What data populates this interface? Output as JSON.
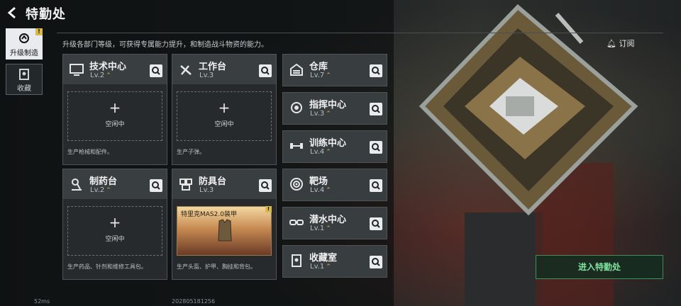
{
  "header": {
    "title": "特勤处",
    "subtitle": "升级各部门等级，可获得专属能力提升，和制造战斗物资的能力。"
  },
  "nav": [
    {
      "label": "升级制造",
      "icon": "upgrade-icon",
      "badge": "!",
      "active": true
    },
    {
      "label": "收藏",
      "icon": "collection-icon",
      "active": false
    }
  ],
  "cards": [
    {
      "name": "技术中心",
      "level": "Lv.2",
      "icon": "monitor-icon",
      "slot_label": "空闲中",
      "slot_plus": "+",
      "desc": "生产枪械和配件。"
    },
    {
      "name": "工作台",
      "level": "Lv.3",
      "icon": "hammer-icon",
      "slot_label": "空闲中",
      "slot_plus": "+",
      "desc": "生产子弹。"
    },
    {
      "name": "制药台",
      "level": "Lv.2",
      "icon": "microscope-icon",
      "slot_label": "空闲中",
      "slot_plus": "+",
      "desc": "生产药品、针剂和维修工具包。"
    },
    {
      "name": "防具台",
      "level": "Lv.3",
      "icon": "armor-icon",
      "product": "特里克MAS2.0装甲",
      "product_badge": "!",
      "desc": "生产头盔、护甲、胸挂和背包。"
    }
  ],
  "facilities": [
    {
      "name": "仓库",
      "level": "Lv.7",
      "icon": "warehouse-icon"
    },
    {
      "name": "指挥中心",
      "level": "Lv.3",
      "icon": "command-icon"
    },
    {
      "name": "训练中心",
      "level": "Lv.4",
      "icon": "dumbbell-icon"
    },
    {
      "name": "靶场",
      "level": "Lv.4",
      "icon": "target-icon"
    },
    {
      "name": "潜水中心",
      "level": "Lv.1",
      "icon": "goggles-icon"
    },
    {
      "name": "收藏室",
      "level": "Lv.1",
      "icon": "collection-room-icon"
    }
  ],
  "subscribe_label": "订阅",
  "enter_button": "进入特勤处",
  "status": {
    "ping": "52ms",
    "uid": "202805181256"
  },
  "colors": {
    "accent_gold": "#d8b94a",
    "enter_green": "#7fe3a0"
  }
}
